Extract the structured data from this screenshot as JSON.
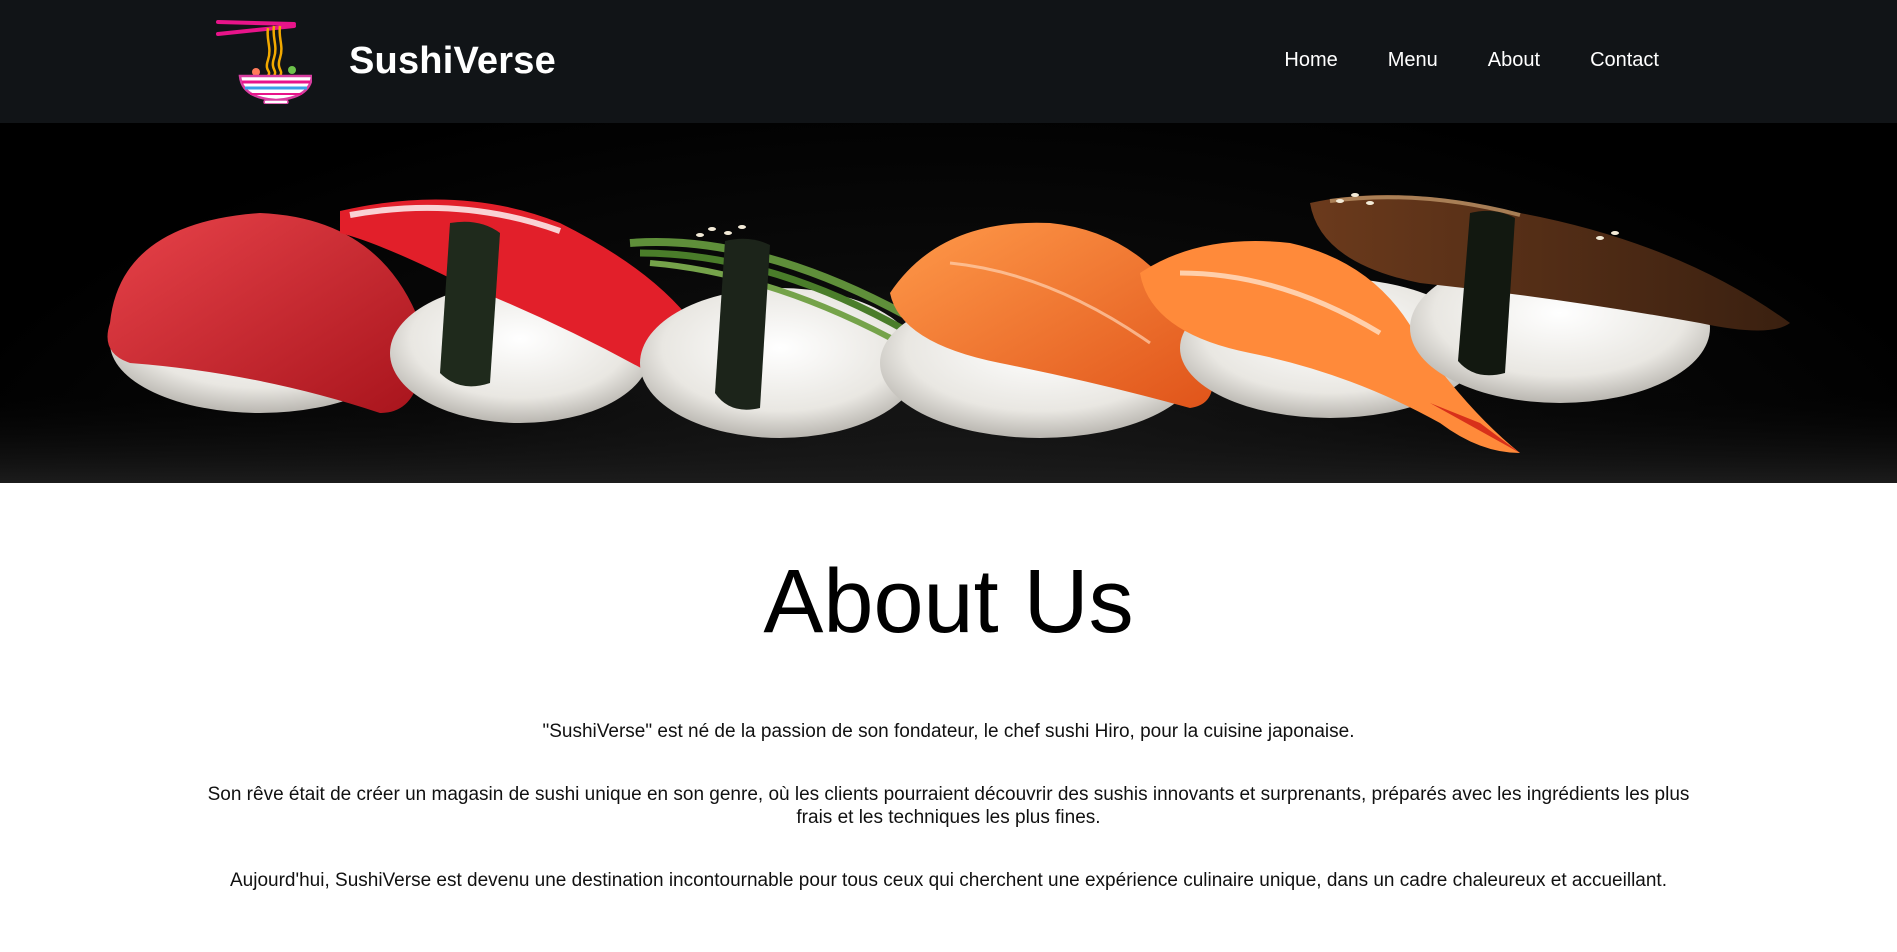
{
  "header": {
    "brand_name": "SushiVerse",
    "logo_icon": "ramen-bowl-chopsticks-icon",
    "nav": [
      {
        "label": "Home"
      },
      {
        "label": "Menu"
      },
      {
        "label": "About"
      },
      {
        "label": "Contact"
      }
    ]
  },
  "hero": {
    "image_subject": "row of nigiri sushi on black background"
  },
  "main": {
    "title": "About Us",
    "paragraphs": [
      "\"SushiVerse\" est né de la passion de son fondateur, le chef sushi Hiro, pour la cuisine japonaise.",
      "Son rêve était de créer un magasin de sushi unique en son genre, où les clients pourraient découvrir des sushis innovants et surprenants, préparés avec les ingrédients les plus frais et les techniques les plus fines.",
      "Aujourd'hui, SushiVerse est devenu une destination incontournable pour tous ceux qui cherchent une expérience culinaire unique, dans un cadre chaleureux et accueillant."
    ]
  },
  "colors": {
    "header_bg": "#111417",
    "header_text": "#ffffff",
    "page_bg": "#ffffff",
    "body_text": "#111111"
  }
}
